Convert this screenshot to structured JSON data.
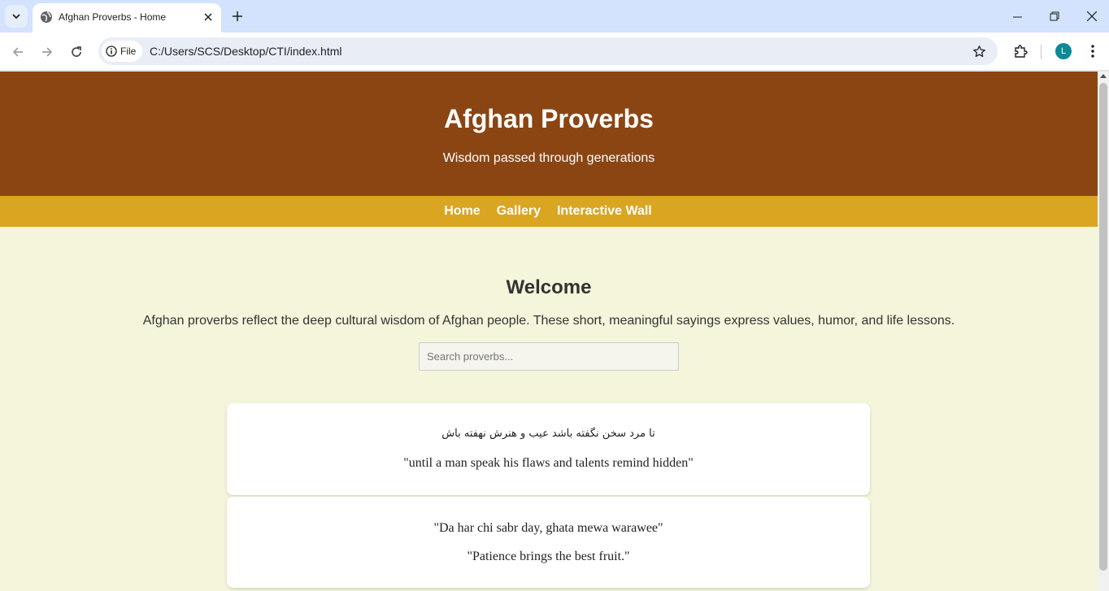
{
  "browser": {
    "tab_title": "Afghan Proverbs - Home",
    "chip_label": "File",
    "url": "C:/Users/SCS/Desktop/CTI/index.html",
    "avatar_letter": "L"
  },
  "site": {
    "title": "Afghan Proverbs",
    "subtitle": "Wisdom passed through generations",
    "nav": [
      "Home",
      "Gallery",
      "Interactive Wall"
    ]
  },
  "main": {
    "heading": "Welcome",
    "intro": "Afghan proverbs reflect the deep cultural wisdom of Afghan people. These short, meaningful sayings express values, humor, and life lessons.",
    "search_placeholder": "Search proverbs..."
  },
  "proverbs": [
    {
      "original": "تا مرد سخن نگفته باشد عیب و هنرش نهفته باش",
      "translation": "\"until a man speak his flaws and talents remind hidden\""
    },
    {
      "original": "\"Da har chi sabr day, ghata mewa warawee\"",
      "translation": "\"Patience brings the best fruit.\""
    }
  ],
  "colors": {
    "header": "#8b4513",
    "nav": "#daa520",
    "background": "#f5f5dc"
  }
}
